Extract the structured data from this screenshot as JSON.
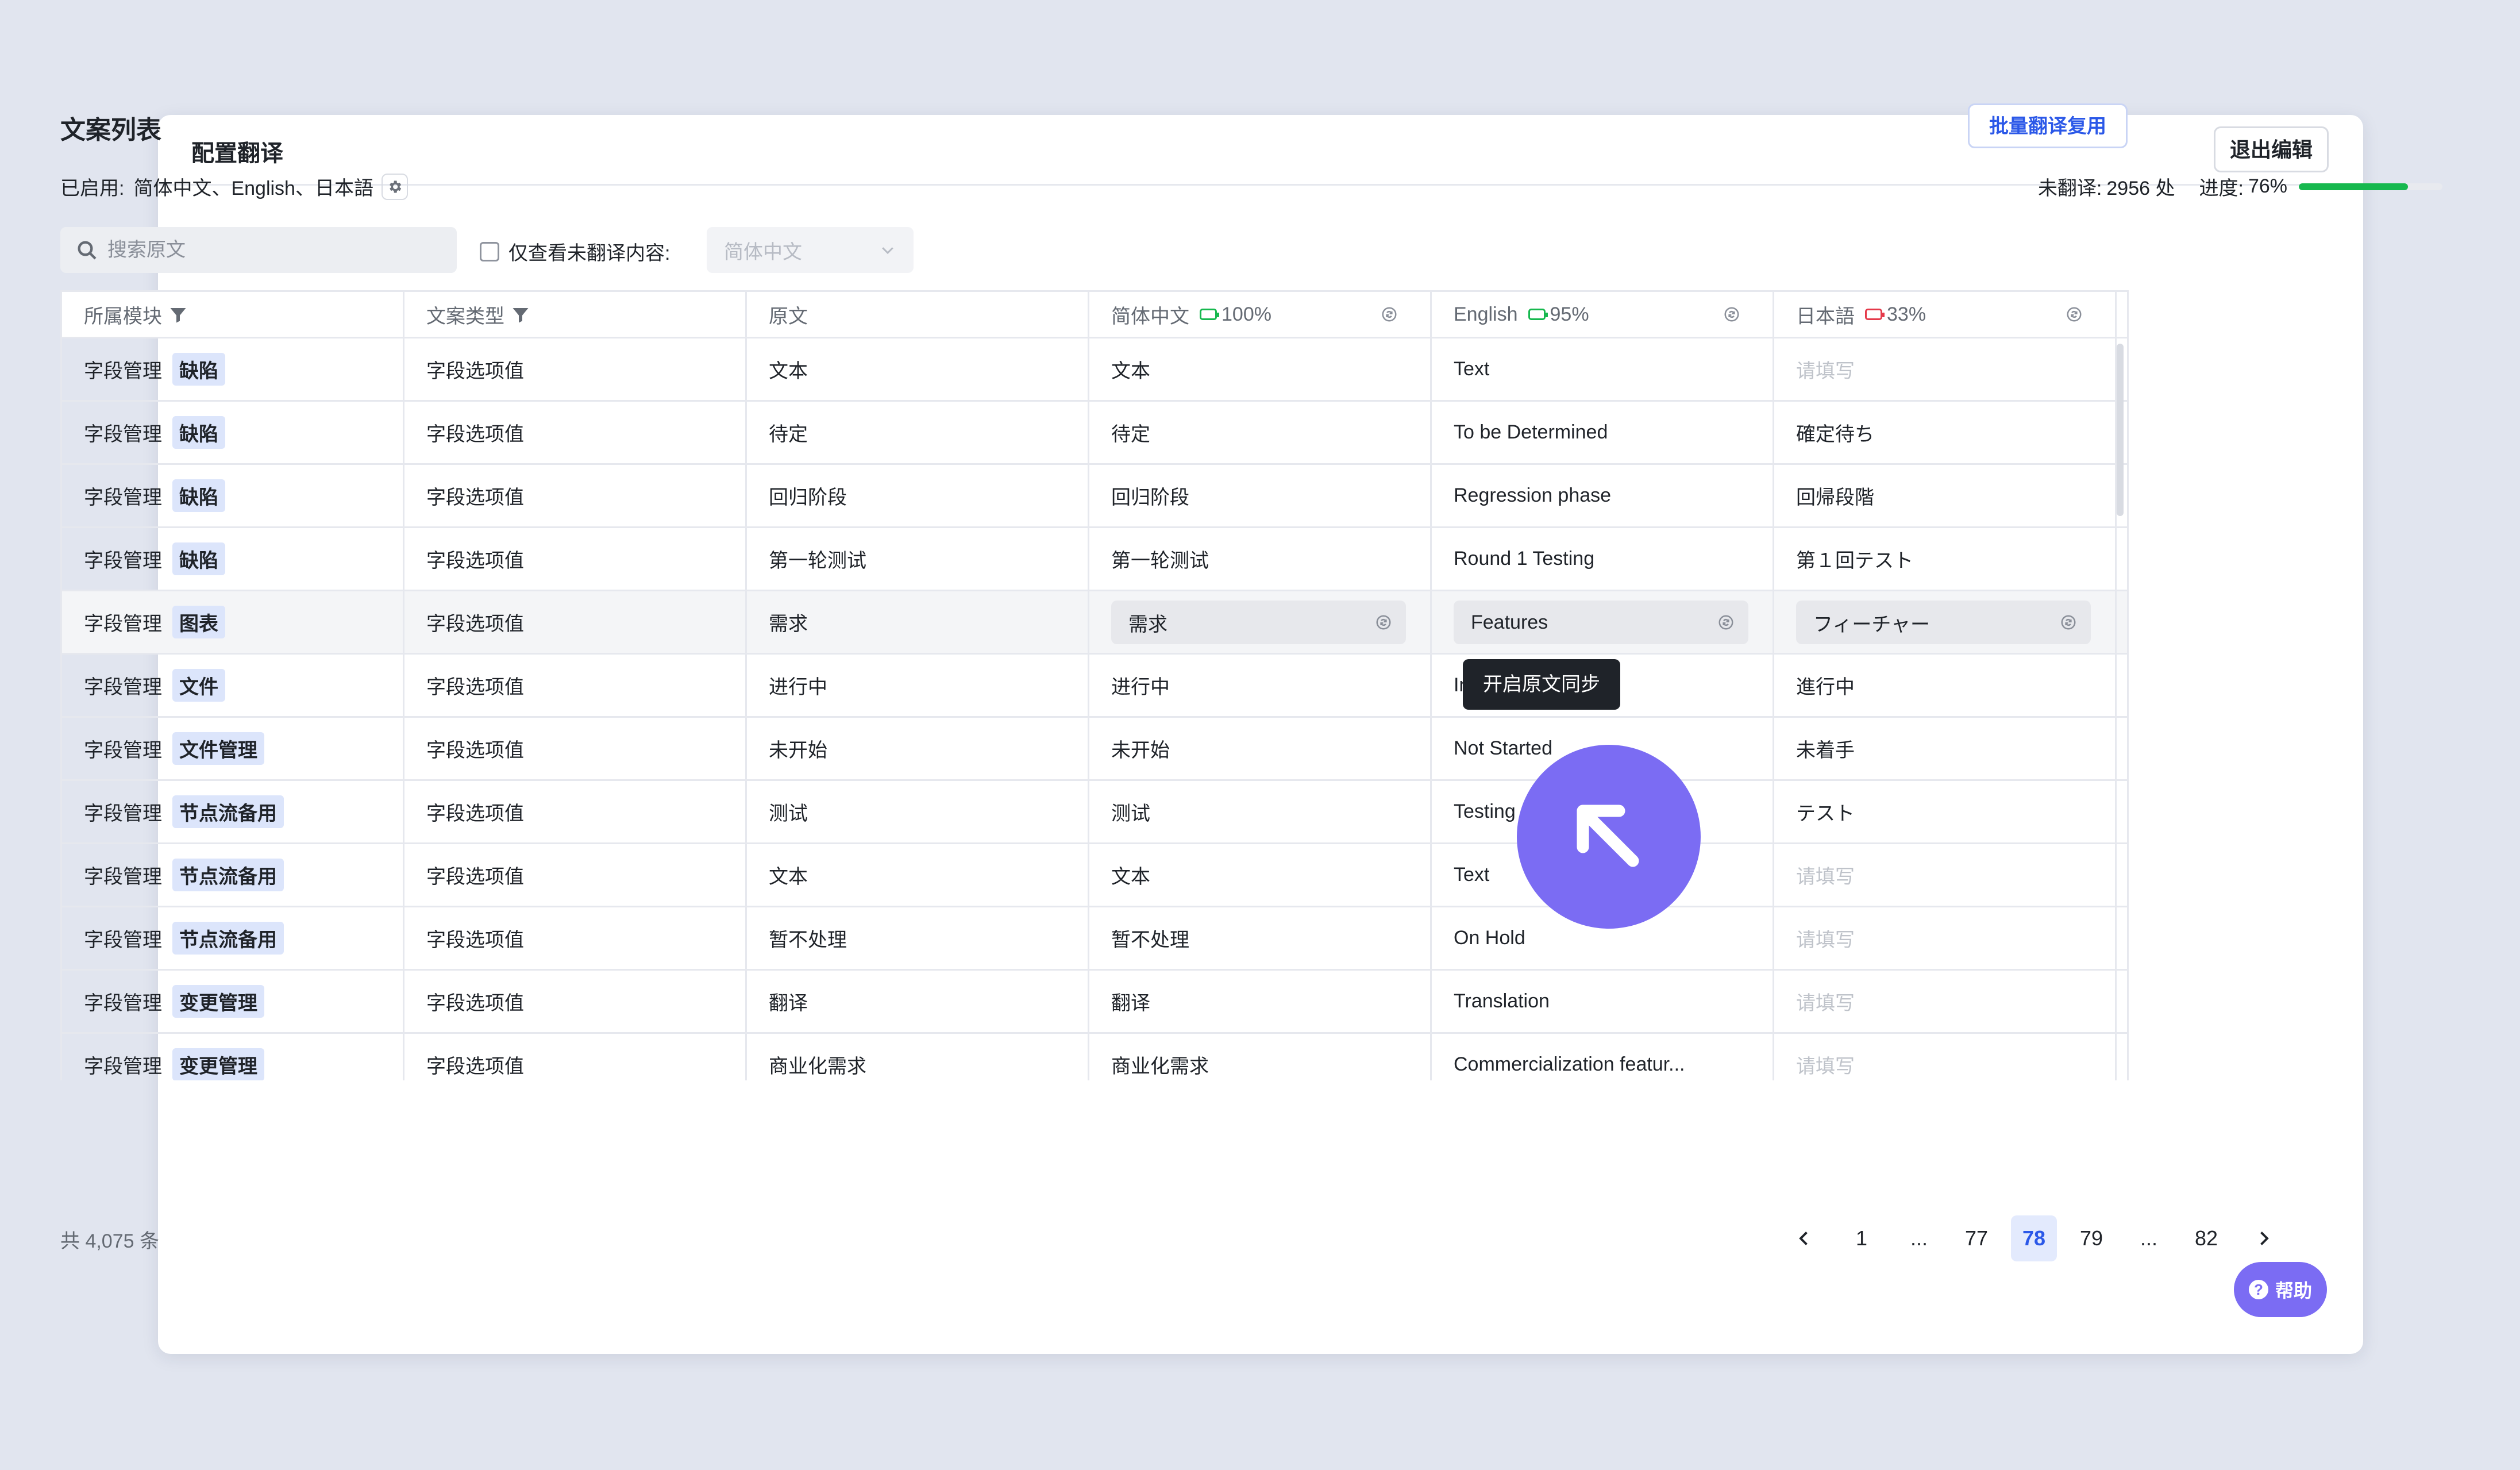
{
  "window": {
    "title": "配置翻译",
    "exit_label": "退出编辑"
  },
  "section": {
    "title": "文案列表",
    "batch_label": "批量翻译复用",
    "enabled_label": "已启用:",
    "enabled_langs": "简体中文、English、日本語",
    "gear_icon": "gear-icon"
  },
  "stats": {
    "untranslated_label": "未翻译:",
    "untranslated_value": "2956 处",
    "progress_label": "进度:",
    "progress_value": "76%",
    "progress_fraction": 0.76,
    "progress_color": "#16b84e"
  },
  "filters": {
    "search_placeholder": "搜索原文",
    "only_untranslated_label": "仅查看未翻译内容:",
    "lang_select_value": "简体中文"
  },
  "columns": [
    {
      "label": "所属模块",
      "filter": true
    },
    {
      "label": "文案类型",
      "filter": true
    },
    {
      "label": "原文"
    },
    {
      "label": "简体中文",
      "pct": "100%",
      "batt_color": "#16b84e",
      "sync": true
    },
    {
      "label": "English",
      "pct": "95%",
      "batt_color": "#16b84e",
      "sync": true
    },
    {
      "label": "日本語",
      "pct": "33%",
      "batt_color": "#e5394a",
      "sync": true
    }
  ],
  "rows": [
    {
      "module": "字段管理",
      "tag": "缺陷",
      "type": "字段选项值",
      "source": "文本",
      "zh": "文本",
      "en": "Text",
      "ja": "请填写",
      "ja_empty": true
    },
    {
      "module": "字段管理",
      "tag": "缺陷",
      "type": "字段选项值",
      "source": "待定",
      "zh": "待定",
      "en": "To be Determined",
      "ja": "確定待ち"
    },
    {
      "module": "字段管理",
      "tag": "缺陷",
      "type": "字段选项值",
      "source": "回归阶段",
      "zh": "回归阶段",
      "en": "Regression phase",
      "ja": "回帰段階"
    },
    {
      "module": "字段管理",
      "tag": "缺陷",
      "type": "字段选项值",
      "source": "第一轮测试",
      "zh": "第一轮测试",
      "en": "Round 1 Testing",
      "ja": "第１回テスト"
    },
    {
      "module": "字段管理",
      "tag": "图表",
      "type": "字段选项值",
      "source": "需求",
      "zh": "需求",
      "en": "Features",
      "ja": "フィーチャー",
      "editing": true
    },
    {
      "module": "字段管理",
      "tag": "文件",
      "type": "字段选项值",
      "source": "进行中",
      "zh": "进行中",
      "en": "In Progress",
      "ja": "進行中"
    },
    {
      "module": "字段管理",
      "tag": "文件管理",
      "type": "字段选项值",
      "source": "未开始",
      "zh": "未开始",
      "en": "Not Started",
      "ja": "未着手"
    },
    {
      "module": "字段管理",
      "tag": "节点流备用",
      "type": "字段选项值",
      "source": "测试",
      "zh": "测试",
      "en": "Testing",
      "ja": "テスト"
    },
    {
      "module": "字段管理",
      "tag": "节点流备用",
      "type": "字段选项值",
      "source": "文本",
      "zh": "文本",
      "en": "Text",
      "ja": "请填写",
      "ja_empty": true
    },
    {
      "module": "字段管理",
      "tag": "节点流备用",
      "type": "字段选项值",
      "source": "暂不处理",
      "zh": "暂不处理",
      "en": "On Hold",
      "ja": "请填写",
      "ja_empty": true
    },
    {
      "module": "字段管理",
      "tag": "变更管理",
      "type": "字段选项值",
      "source": "翻译",
      "zh": "翻译",
      "en": "Translation",
      "ja": "请填写",
      "ja_empty": true
    },
    {
      "module": "字段管理",
      "tag": "变更管理",
      "type": "字段选项值",
      "source": "商业化需求",
      "zh": "商业化需求",
      "en": "Commercialization featur...",
      "ja": "请填写",
      "ja_empty": true
    }
  ],
  "tooltip": "开启原文同步",
  "footer": {
    "total": "共 4,075 条",
    "pages": [
      "1",
      "...",
      "77",
      "78",
      "79",
      "...",
      "82"
    ],
    "active_page": "78"
  },
  "help_label": "帮助",
  "colors": {
    "accent": "#2b58e8",
    "cursor": "#7b6cf3",
    "tag_bg": "#dce5fb"
  }
}
